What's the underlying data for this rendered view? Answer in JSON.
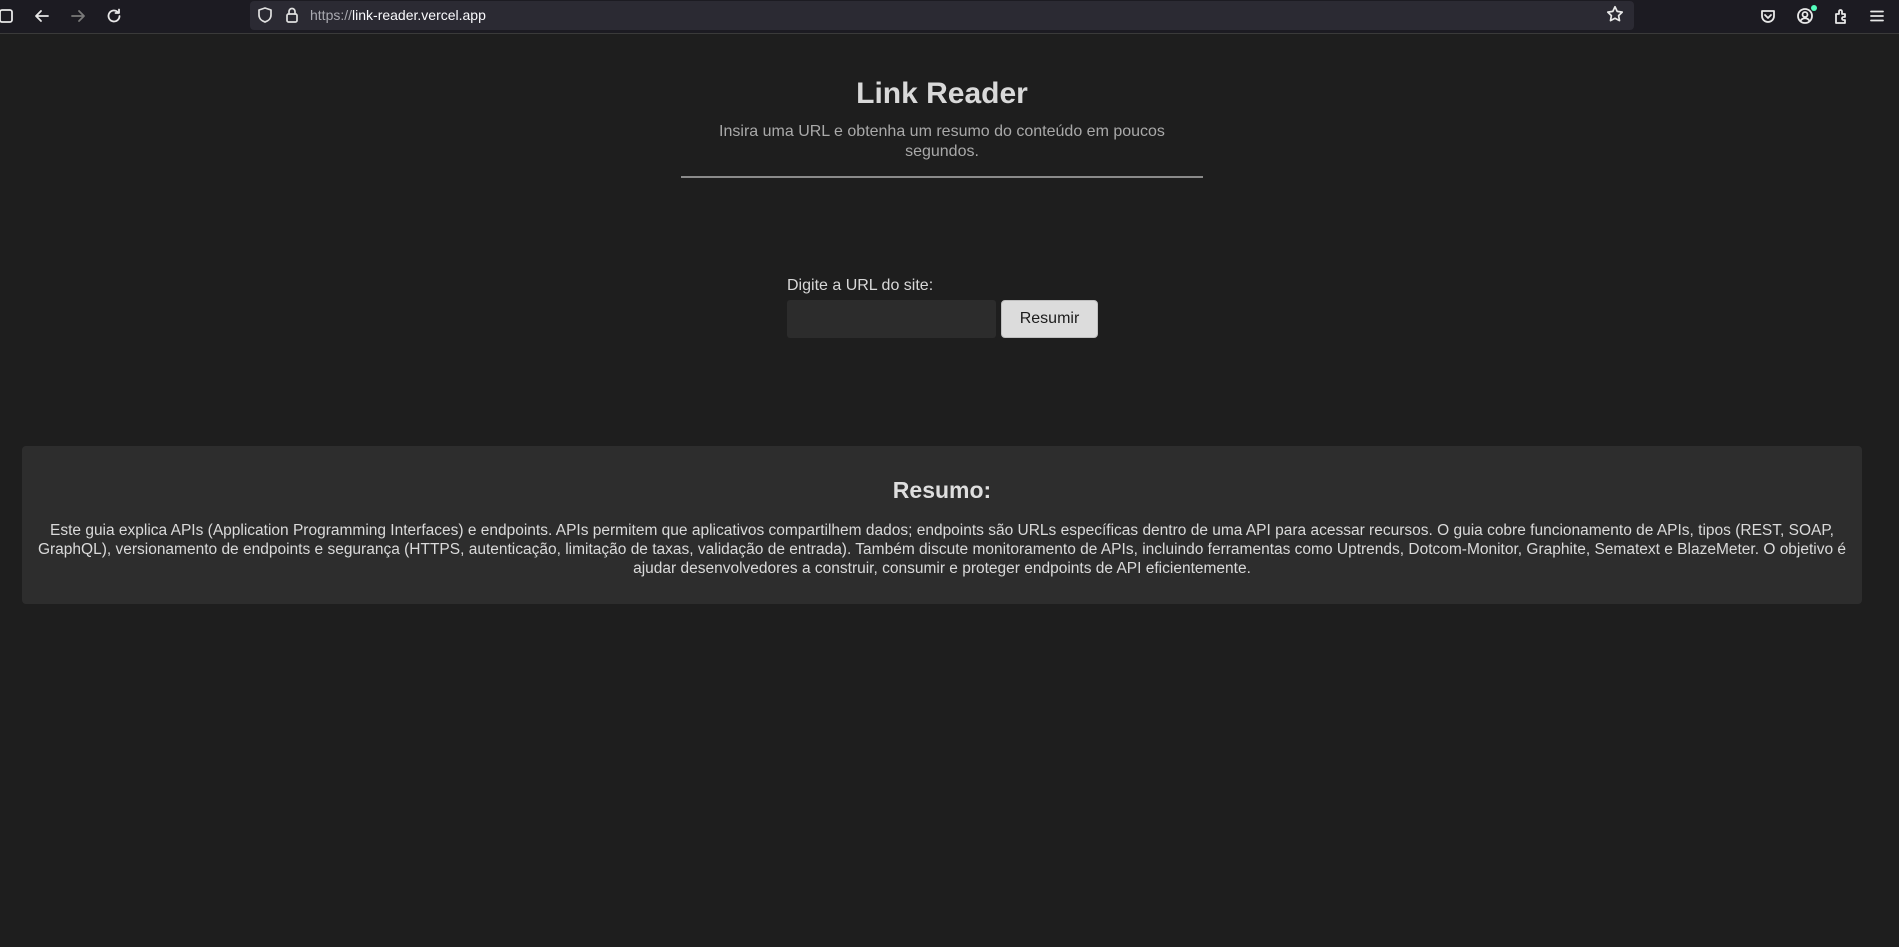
{
  "browser": {
    "url_protocol": "https://",
    "url_host": "link-reader.vercel.app"
  },
  "page": {
    "title": "Link Reader",
    "subtitle": "Insira uma URL e obtenha um resumo do conteúdo em poucos segundos.",
    "form": {
      "label": "Digite a URL do site:",
      "input_value": "",
      "input_placeholder": "",
      "submit_label": "Resumir"
    },
    "summary": {
      "heading": "Resumo:",
      "text": "Este guia explica APIs (Application Programming Interfaces) e endpoints. APIs permitem que aplicativos compartilhem dados; endpoints são URLs específicas dentro de uma API para acessar recursos. O guia cobre funcionamento de APIs, tipos (REST, SOAP, GraphQL), versionamento de endpoints e segurança (HTTPS, autenticação, limitação de taxas, validação de entrada). Também discute monitoramento de APIs, incluindo ferramentas como Uptrends, Dotcom-Monitor, Graphite, Sematext e BlazeMeter. O objetivo é ajudar desenvolvedores a construir, consumir e proteger endpoints de API eficientemente."
    }
  },
  "colors": {
    "page_background": "#1e1e1e",
    "card_background": "#2d2d2d",
    "button_background": "#dcdcdc",
    "toolbar_background": "#1c1b22"
  },
  "icons": {
    "sidebar": "sidebar-icon",
    "back": "back-arrow-icon",
    "forward": "forward-arrow-icon",
    "reload": "reload-icon",
    "tracking_protection": "shield-icon",
    "secure": "lock-icon",
    "bookmark": "star-icon",
    "pocket": "pocket-icon",
    "account": "account-icon",
    "extensions": "extensions-icon",
    "menu": "hamburger-menu-icon"
  }
}
